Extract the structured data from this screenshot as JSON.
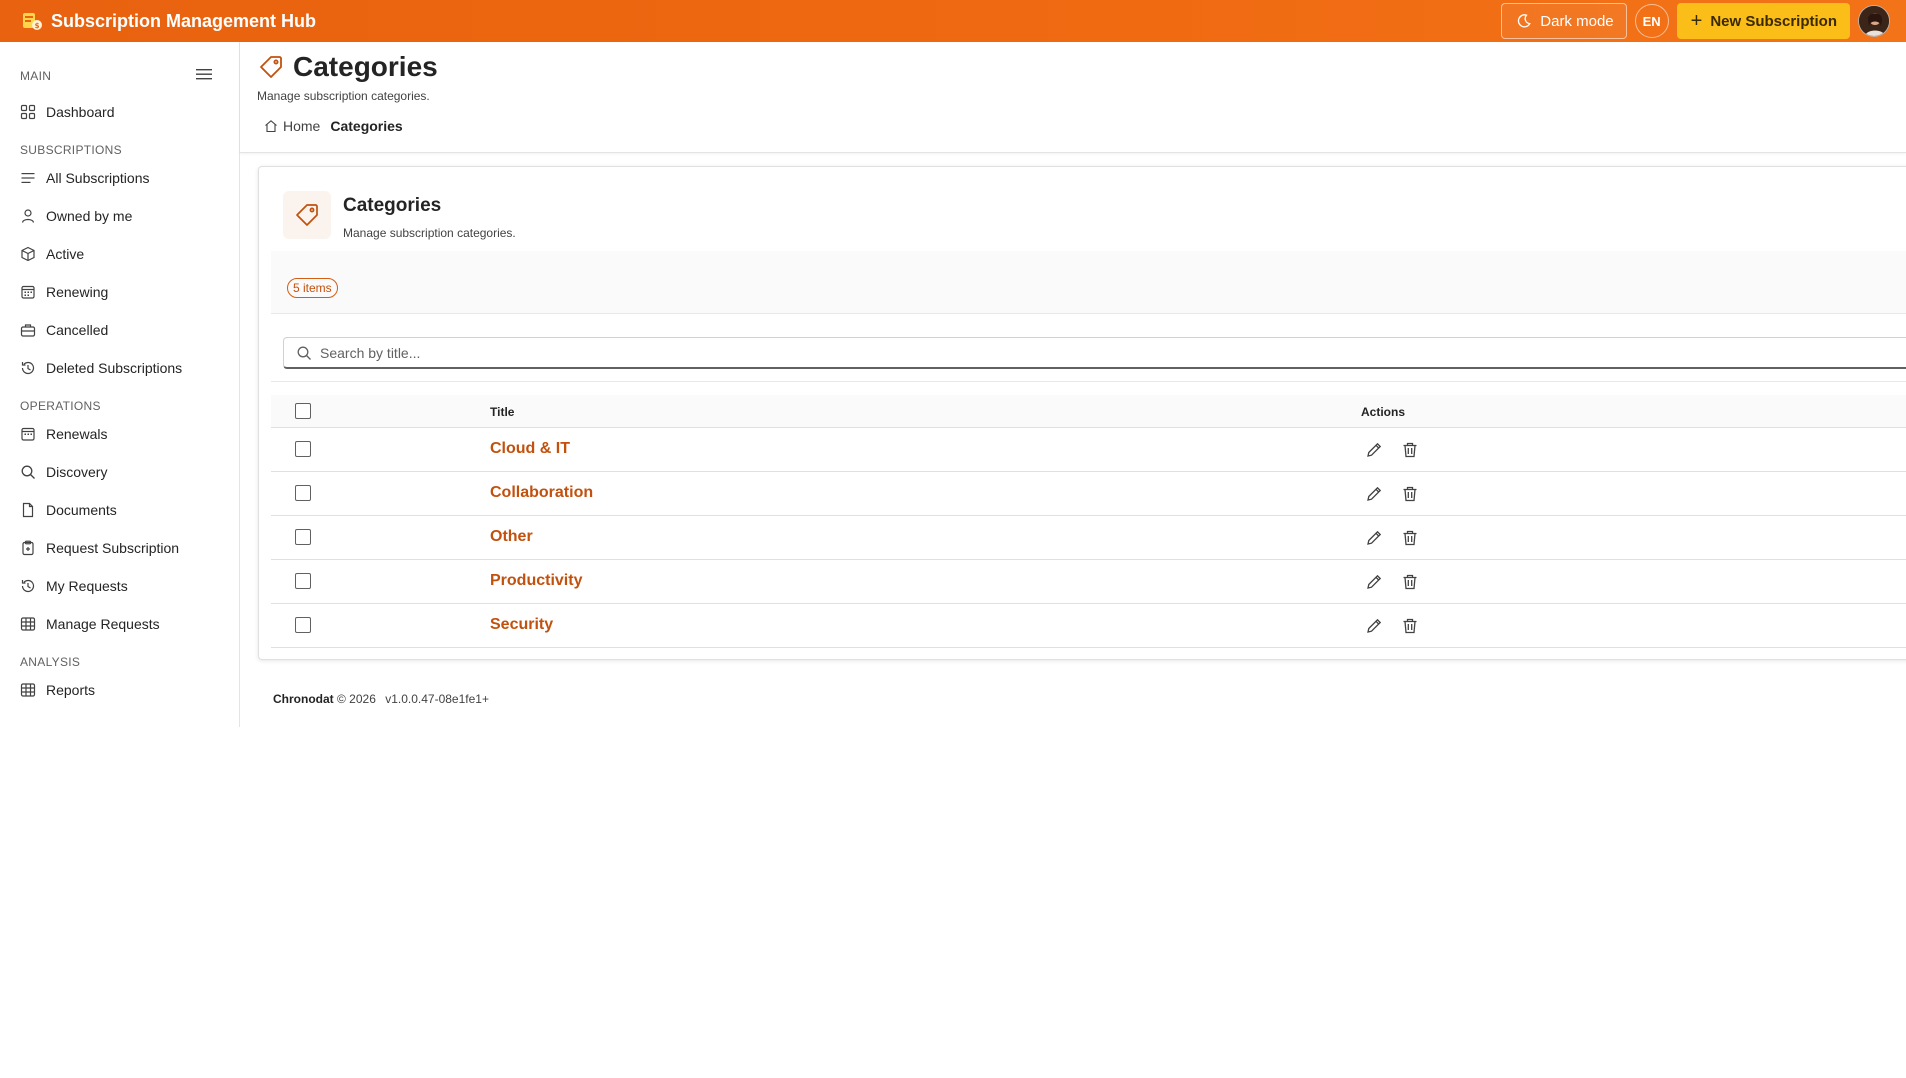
{
  "app": {
    "title": "Subscription Management Hub"
  },
  "topbar": {
    "dark_mode_label": "Dark mode",
    "language_label": "EN",
    "new_subscription_label": "New Subscription"
  },
  "sidebar": {
    "sections": [
      {
        "label": "MAIN"
      },
      {
        "label": "SUBSCRIPTIONS"
      },
      {
        "label": "OPERATIONS"
      },
      {
        "label": "ANALYSIS"
      }
    ],
    "items": [
      {
        "label": "Dashboard",
        "icon": "dashboard-grid-icon"
      },
      {
        "label": "All Subscriptions",
        "icon": "list-icon"
      },
      {
        "label": "Owned by me",
        "icon": "person-icon"
      },
      {
        "label": "Active",
        "icon": "box-icon"
      },
      {
        "label": "Renewing",
        "icon": "calendar-icon"
      },
      {
        "label": "Cancelled",
        "icon": "briefcase-icon"
      },
      {
        "label": "Deleted Subscriptions",
        "icon": "history-icon"
      },
      {
        "label": "Renewals",
        "icon": "calendar-icon"
      },
      {
        "label": "Discovery",
        "icon": "search-icon"
      },
      {
        "label": "Documents",
        "icon": "document-icon"
      },
      {
        "label": "Request Subscription",
        "icon": "clipboard-icon"
      },
      {
        "label": "My Requests",
        "icon": "history-icon"
      },
      {
        "label": "Manage Requests",
        "icon": "table-icon"
      },
      {
        "label": "Reports",
        "icon": "table-icon"
      }
    ]
  },
  "page": {
    "title": "Categories",
    "subtitle": "Manage subscription categories.",
    "breadcrumb": {
      "home": "Home",
      "current": "Categories"
    }
  },
  "card": {
    "title": "Categories",
    "subtitle": "Manage subscription categories.",
    "count_badge": "5 items",
    "search_placeholder": "Search by title...",
    "columns": {
      "title": "Title",
      "actions": "Actions"
    },
    "rows": [
      {
        "title": "Cloud & IT"
      },
      {
        "title": "Collaboration"
      },
      {
        "title": "Other"
      },
      {
        "title": "Productivity"
      },
      {
        "title": "Security"
      }
    ]
  },
  "footer": {
    "brand": "Chronodat",
    "copyright": "© 2026",
    "version": "v1.0.0.47-08e1fe1+"
  },
  "colors": {
    "topbar": "#f06a12",
    "accent": "#c2510e",
    "new_button": "#fbbd17"
  }
}
